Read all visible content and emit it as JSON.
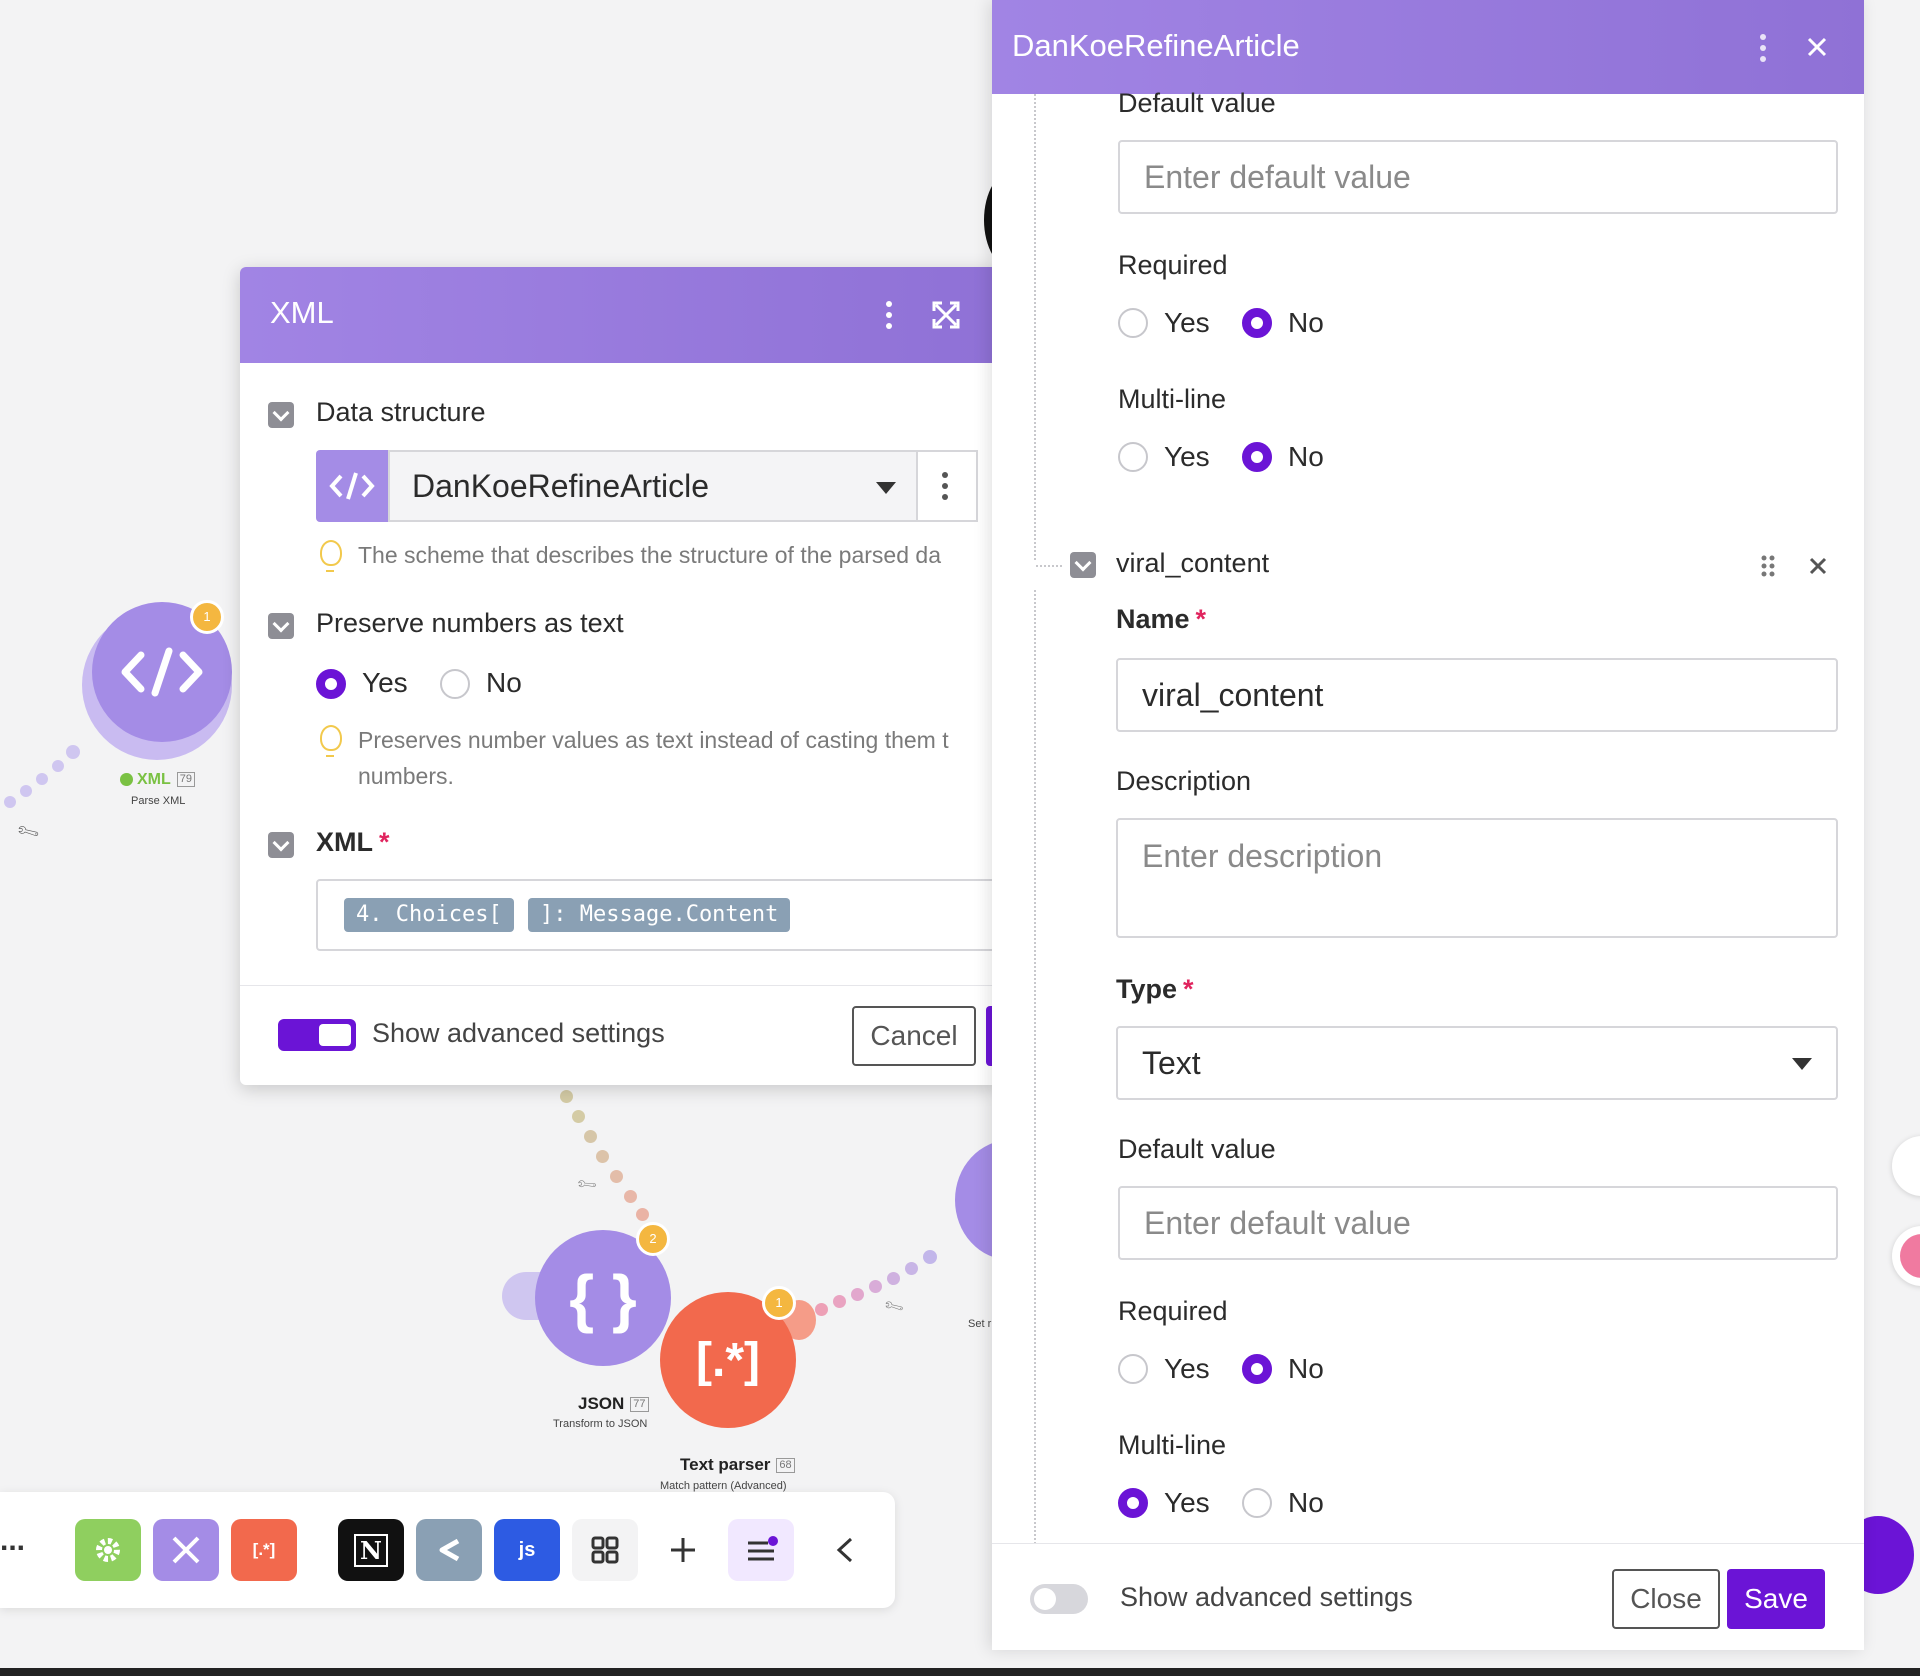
{
  "canvas": {
    "xml_node": {
      "label": "XML",
      "id": "79",
      "sublabel": "Parse XML",
      "badge": "1"
    },
    "json_node": {
      "label": "JSON",
      "id": "77",
      "sublabel": "Transform to JSON",
      "badge": "2"
    },
    "text_parser_node": {
      "label": "Text parser",
      "id": "68",
      "sublabel": "Match pattern (Advanced)",
      "badge": "1"
    },
    "set_node": {
      "sublabel": "Set r"
    },
    "colors": {
      "xml": "#a48ce6",
      "json": "#a48ce6",
      "text_parser": "#f2694d"
    }
  },
  "toolbar": {
    "more_label": "...",
    "items": [
      {
        "name": "gear-icon",
        "color": "#8fcf5f"
      },
      {
        "name": "tools-icon",
        "color": "#a48ce6"
      },
      {
        "name": "text-parser-icon",
        "color": "#f2694d",
        "text": "[.*]"
      },
      {
        "name": "notion-icon",
        "color": "#111111",
        "text": "N"
      },
      {
        "name": "share-icon",
        "color": "#8aa0b4"
      },
      {
        "name": "javascript-icon",
        "color": "#2d5be3",
        "text": "js"
      },
      {
        "name": "grid-icon",
        "color": "#f3f3f4"
      },
      {
        "name": "plus-icon",
        "color": "#ffffff"
      },
      {
        "name": "flow-control-icon",
        "color": "#f1e8ff"
      },
      {
        "name": "chevron-left-icon",
        "color": "#ffffff"
      }
    ]
  },
  "xml_dialog": {
    "title": "XML",
    "data_structure": {
      "label": "Data structure",
      "value": "DanKoeRefineArticle",
      "hint": "The scheme that describes the structure of the parsed da"
    },
    "preserve_numbers": {
      "label": "Preserve numbers as text",
      "yes": "Yes",
      "no": "No",
      "selected": "Yes",
      "hint_line1": "Preserves number values as text instead of casting them t",
      "hint_line2": "numbers."
    },
    "xml_field": {
      "label": "XML",
      "required_mark": "*",
      "pill1": "4. Choices[",
      "pill2": "]: Message.Content"
    },
    "footer": {
      "advanced_label": "Show advanced settings",
      "advanced_on": true,
      "cancel": "Cancel"
    }
  },
  "ds_panel": {
    "title": "DanKoeRefineArticle",
    "top_item": {
      "default_value_label": "Default value",
      "default_value_placeholder": "Enter default value",
      "required_label": "Required",
      "multiline_label": "Multi-line",
      "yes": "Yes",
      "no": "No",
      "required_selected": "No",
      "multiline_selected": "No"
    },
    "item": {
      "header": "viral_content",
      "name_label": "Name",
      "required_mark": "*",
      "name_value": "viral_content",
      "description_label": "Description",
      "description_placeholder": "Enter description",
      "type_label": "Type",
      "type_value": "Text",
      "default_value_label": "Default value",
      "default_value_placeholder": "Enter default value",
      "required_label": "Required",
      "multiline_label": "Multi-line",
      "yes": "Yes",
      "no": "No",
      "required_selected": "No",
      "multiline_selected": "Yes"
    },
    "footer": {
      "advanced_label": "Show advanced settings",
      "advanced_on": false,
      "close": "Close",
      "save": "Save"
    }
  },
  "accent_color": "#6b14d6",
  "header_color": "#9b7fe0"
}
